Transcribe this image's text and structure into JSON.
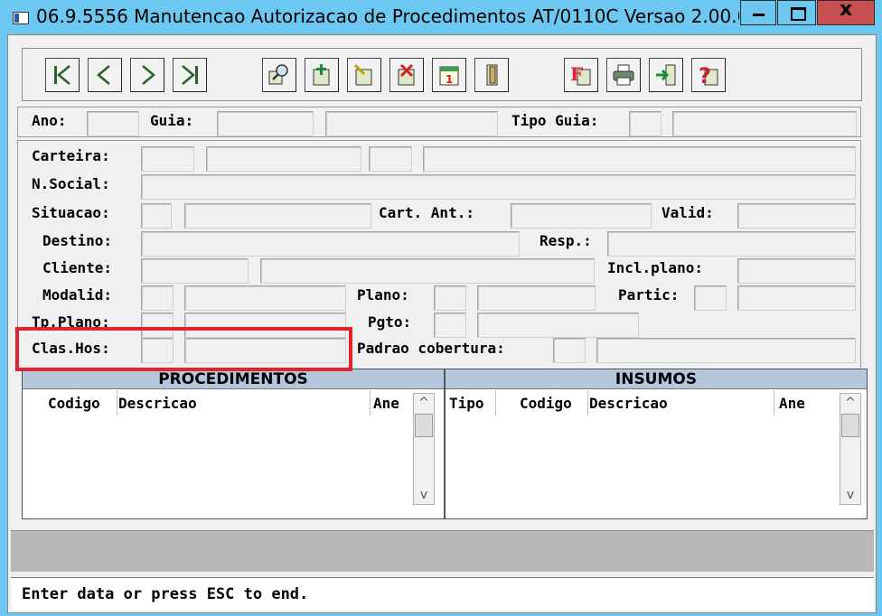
{
  "window": {
    "title": "06.9.5556 Manutencao Autorizacao de Procedimentos AT/0110C Versao 2.00.0..."
  },
  "toolbar": {
    "buttons": [
      {
        "name": "first-record",
        "icon": "first-record-icon"
      },
      {
        "name": "previous-record",
        "icon": "previous-record-icon"
      },
      {
        "name": "next-record",
        "icon": "next-record-icon"
      },
      {
        "name": "last-record",
        "icon": "last-record-icon"
      },
      {
        "name": "search",
        "icon": "zoom-search-icon"
      },
      {
        "name": "add",
        "icon": "add-record-icon"
      },
      {
        "name": "edit",
        "icon": "edit-record-icon"
      },
      {
        "name": "delete",
        "icon": "delete-record-icon"
      },
      {
        "name": "go-to",
        "icon": "calendar-goto-icon"
      },
      {
        "name": "exit",
        "icon": "door-exit-icon"
      },
      {
        "name": "filter",
        "icon": "filter-f-icon",
        "letter": "F"
      },
      {
        "name": "print",
        "icon": "printer-icon"
      },
      {
        "name": "export",
        "icon": "export-arrow-icon"
      },
      {
        "name": "help",
        "icon": "help-question-icon",
        "letter": "?"
      }
    ]
  },
  "header": {
    "ano_label": "Ano:",
    "guia_label": "Guia:",
    "tipo_guia_label": "Tipo Guia:"
  },
  "form": {
    "carteira_label": "Carteira:",
    "nsocial_label": "N.Social:",
    "situacao_label": "Situacao:",
    "cart_ant_label": "Cart. Ant.:",
    "valid_label": "Valid:",
    "destino_label": "Destino:",
    "resp_label": "Resp.:",
    "cliente_label": "Cliente:",
    "incl_plano_label": "Incl.plano:",
    "modalid_label": "Modalid:",
    "plano_label": "Plano:",
    "partic_label": "Partic:",
    "tp_plano_label": "Tp.Plano:",
    "pgto_label": "Pgto:",
    "clas_hos_label": "Clas.Hos:",
    "padrao_cobertura_label": "Padrao cobertura:"
  },
  "procedimentos": {
    "title": "PROCEDIMENTOS",
    "columns": [
      "Codigo",
      "Descricao",
      "Ane"
    ]
  },
  "insumos": {
    "title": "INSUMOS",
    "columns": [
      "Tipo",
      "Codigo",
      "Descricao",
      "Ane"
    ]
  },
  "scrollbar": {
    "up_glyph": "^",
    "down_glyph": "v"
  },
  "status": {
    "message": "Enter data or press ESC to end."
  },
  "colors": {
    "title_bar": "#6cc8f0",
    "close_button": "#c75050",
    "grid_header": "#b4c7dc",
    "highlight_box": "#e0262c",
    "filter_letter": "#e0262c"
  }
}
